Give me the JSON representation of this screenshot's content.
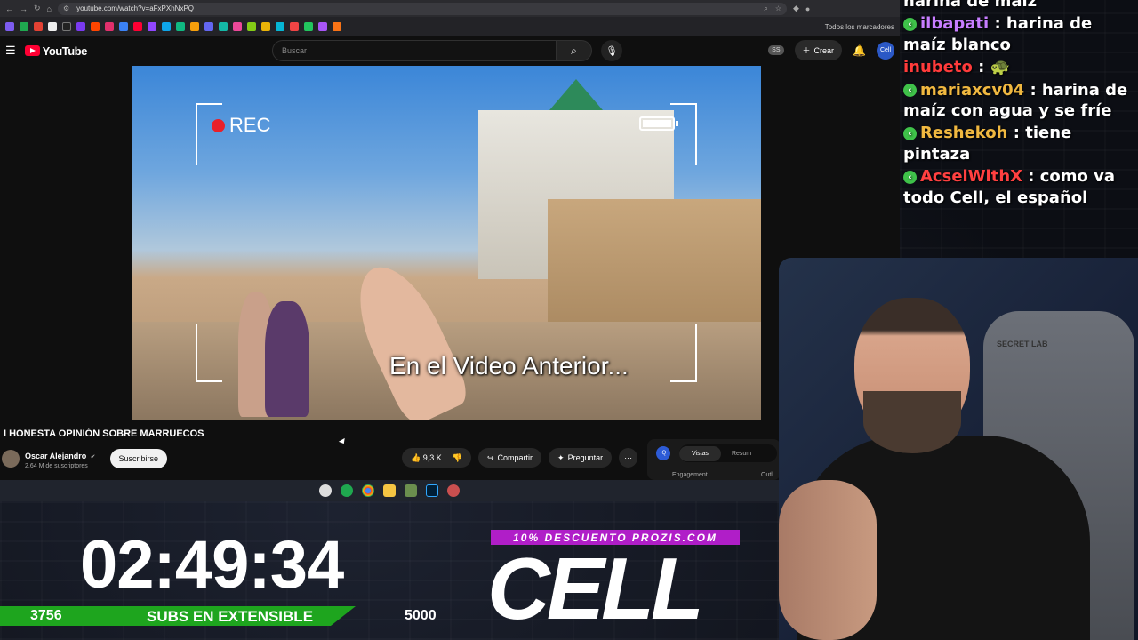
{
  "browser": {
    "url": "youtube.com/watch?v=aFxPXhNxPQ",
    "bookmarks_folder": "Todos los marcadores"
  },
  "youtube": {
    "logo_text": "YouTube",
    "search_placeholder": "Buscar",
    "ss_badge": "SS",
    "create_label": "Crear",
    "avatar_text": "Cell"
  },
  "video": {
    "rec_label": "REC",
    "caption": "En el Video Anterior...",
    "title": "I HONESTA OPINIÓN SOBRE MARRUECOS",
    "channel": "Oscar Alejandro",
    "subscribers": "2,64 M de suscriptores",
    "subscribe_label": "Suscribirse",
    "likes": "9,3 K",
    "share_label": "Compartir",
    "ask_label": "Preguntar",
    "more_label": "···"
  },
  "side_panel": {
    "badge": "IQ",
    "tab_active": "Vistas",
    "tab_other": "Resum",
    "engagement": "Engagement",
    "outline": "Outli"
  },
  "chat": [
    {
      "user": "",
      "text": "harina de maíz",
      "color": "#ffffff"
    },
    {
      "user": "ilbapati",
      "text": ": harina de maíz blanco",
      "color": "#c77dff"
    },
    {
      "user": "inubeto",
      "text": ": 🐢",
      "color": "#ff3b3b"
    },
    {
      "user": "mariaxcv04",
      "text": ": harina de maíz con agua y se fríe",
      "color": "#f0b840"
    },
    {
      "user": "Reshekoh",
      "text": ": tiene pintaza",
      "color": "#f0b840"
    },
    {
      "user": "AcselWithX",
      "text": ": como va todo Cell, el español",
      "color": "#ff4040"
    }
  ],
  "stream": {
    "timer": "02:49:34",
    "subs_current": "3756",
    "subs_label": "SUBS EN EXTENSIBLE",
    "subs_goal": "5000",
    "promo": "10% DESCUENTO PROZIS.COM",
    "brand": "CELL",
    "chair_brand": "SECRET LAB"
  },
  "colors": {
    "accent_green": "#1ea51e",
    "promo_purple": "#b01ec8",
    "yt_red": "#ff0033"
  }
}
